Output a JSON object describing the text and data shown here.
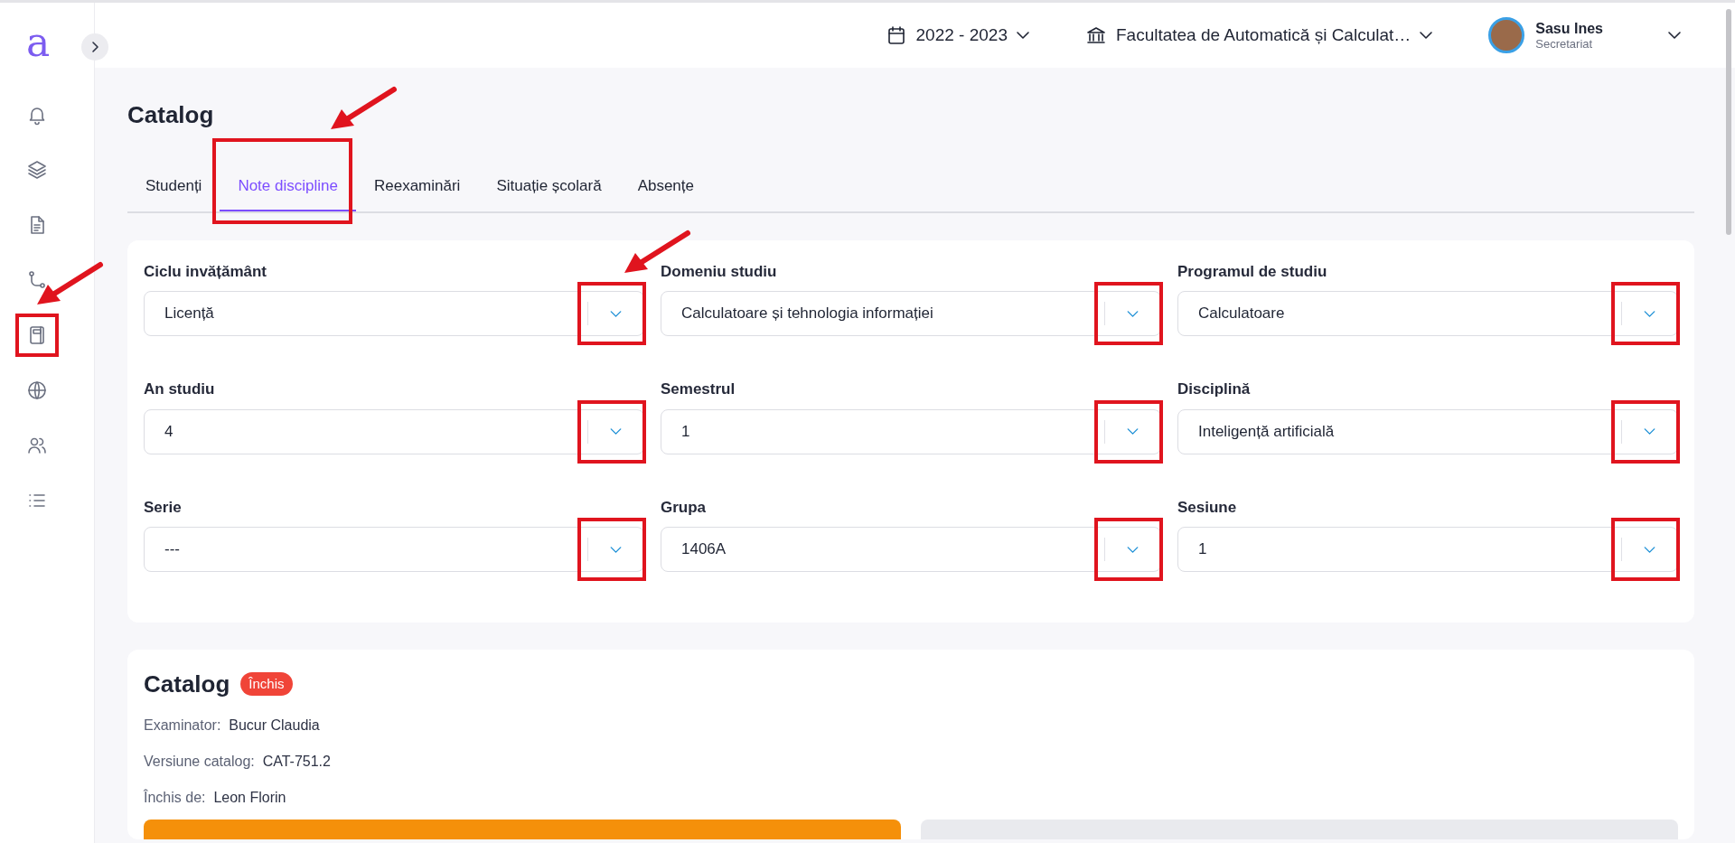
{
  "sidebar": {
    "logo": "a",
    "items": [
      {
        "highlighted": false,
        "arrow": false
      },
      {
        "highlighted": false,
        "arrow": false
      },
      {
        "highlighted": false,
        "arrow": false
      },
      {
        "highlighted": false,
        "arrow": false
      },
      {
        "highlighted": true,
        "arrow": true
      },
      {
        "highlighted": false,
        "arrow": false
      },
      {
        "highlighted": false,
        "arrow": false
      },
      {
        "highlighted": false,
        "arrow": false
      }
    ]
  },
  "header": {
    "year": "2022 - 2023",
    "faculty": "Facultatea de Automatică și Calculat…",
    "user": {
      "name": "Sasu Ines",
      "role": "Secretariat"
    }
  },
  "page_title": "Catalog",
  "tabs": [
    {
      "label": "Studenți",
      "selected": false,
      "highlighted": false,
      "arrow": false
    },
    {
      "label": "Note discipline",
      "selected": true,
      "highlighted": true,
      "arrow": true
    },
    {
      "label": "Reexaminări",
      "selected": false,
      "highlighted": false,
      "arrow": false
    },
    {
      "label": "Situație școlară",
      "selected": false,
      "highlighted": false,
      "arrow": false
    },
    {
      "label": "Absențe",
      "selected": false,
      "highlighted": false,
      "arrow": false
    }
  ],
  "filters": [
    {
      "label": "Ciclu invățământ",
      "value": "Licență",
      "highlighted": true,
      "arrow": true
    },
    {
      "label": "Domeniu studiu",
      "value": "Calculatoare și tehnologia informației",
      "highlighted": true,
      "arrow": false
    },
    {
      "label": "Programul de studiu",
      "value": "Calculatoare",
      "highlighted": true,
      "arrow": false
    },
    {
      "label": "An studiu",
      "value": "4",
      "highlighted": true,
      "arrow": false
    },
    {
      "label": "Semestrul",
      "value": "1",
      "highlighted": true,
      "arrow": false
    },
    {
      "label": "Disciplină",
      "value": "Inteligență artificială",
      "highlighted": true,
      "arrow": false
    },
    {
      "label": "Serie",
      "value": "---",
      "highlighted": true,
      "arrow": false
    },
    {
      "label": "Grupa",
      "value": "1406A",
      "highlighted": true,
      "arrow": false
    },
    {
      "label": "Sesiune",
      "value": "1",
      "highlighted": true,
      "arrow": false
    }
  ],
  "catalog": {
    "title": "Catalog",
    "status": "Închis",
    "fields": [
      {
        "label": "Examinator:",
        "value": "Bucur Claudia"
      },
      {
        "label": "Versiune catalog:",
        "value": "CAT-751.2"
      },
      {
        "label": "Închis de:",
        "value": "Leon Florin"
      }
    ]
  },
  "actions": [
    {
      "kind": "primary"
    },
    {
      "kind": "secondary"
    }
  ]
}
